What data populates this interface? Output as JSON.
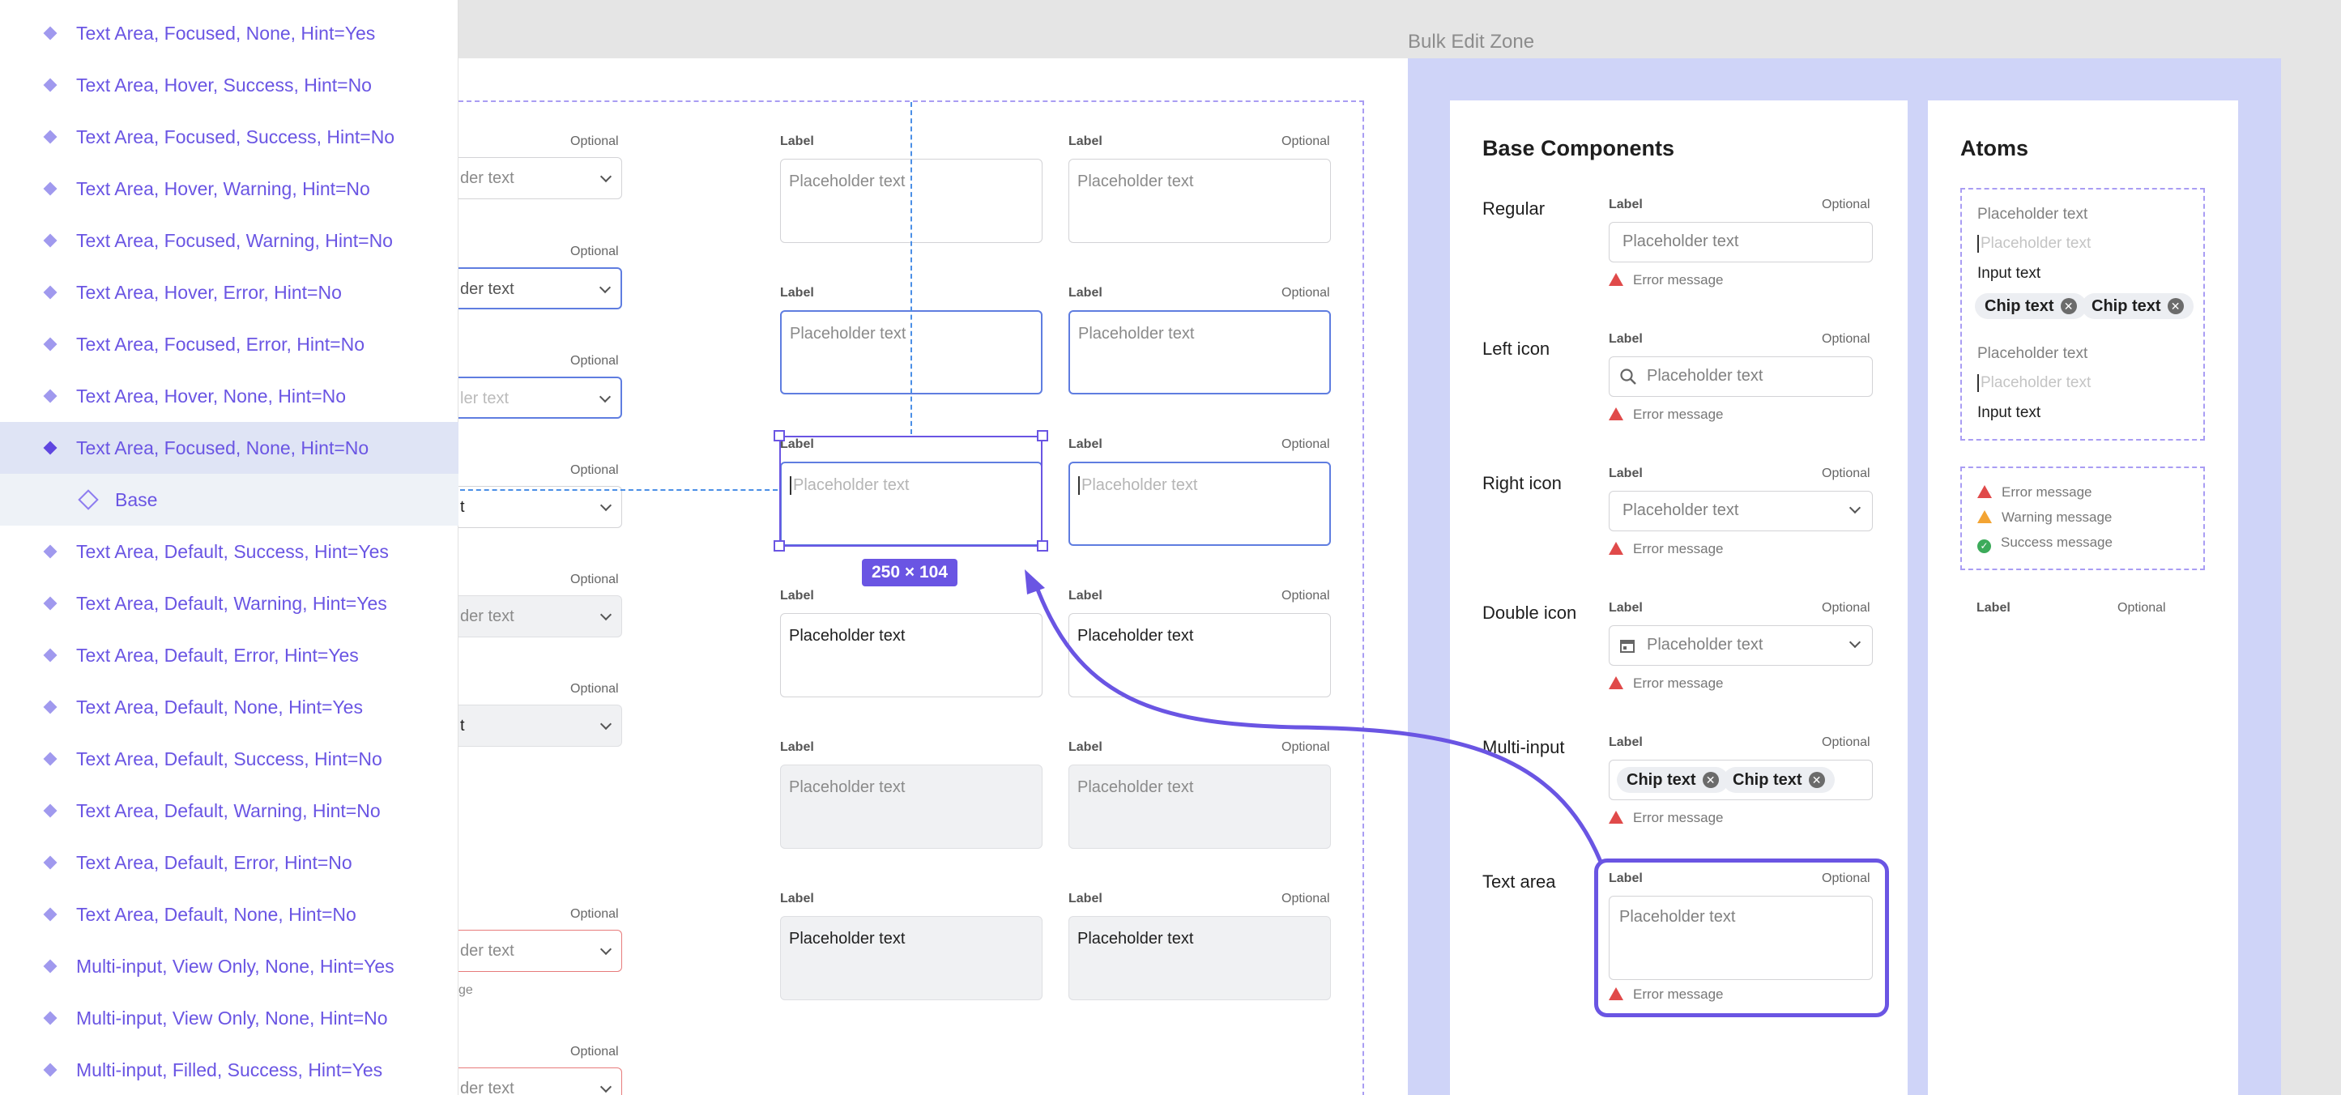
{
  "layers": {
    "items": [
      {
        "label": "Text Area, Focused, None, Hint=Yes"
      },
      {
        "label": "Text Area, Hover, Success, Hint=No"
      },
      {
        "label": "Text Area, Focused, Success, Hint=No"
      },
      {
        "label": "Text Area, Hover, Warning, Hint=No"
      },
      {
        "label": "Text Area, Focused, Warning, Hint=No"
      },
      {
        "label": "Text Area, Hover, Error, Hint=No"
      },
      {
        "label": "Text Area, Focused, Error, Hint=No"
      },
      {
        "label": "Text Area, Hover, None, Hint=No"
      },
      {
        "label": "Text Area, Focused, None, Hint=No"
      },
      {
        "label": "Base"
      },
      {
        "label": "Text Area, Default, Success, Hint=Yes"
      },
      {
        "label": "Text Area, Default, Warning, Hint=Yes"
      },
      {
        "label": "Text Area, Default, Error, Hint=Yes"
      },
      {
        "label": "Text Area, Default, None, Hint=Yes"
      },
      {
        "label": "Text Area, Default, Success, Hint=No"
      },
      {
        "label": "Text Area, Default, Warning, Hint=No"
      },
      {
        "label": "Text Area, Default, Error, Hint=No"
      },
      {
        "label": "Text Area, Default, None, Hint=No"
      },
      {
        "label": "Multi-input, View Only, None, Hint=Yes"
      },
      {
        "label": "Multi-input, View Only, None, Hint=No"
      },
      {
        "label": "Multi-input, Filled, Success, Hint=Yes"
      }
    ]
  },
  "canvas": {
    "label": "Label",
    "optional": "Optional",
    "placeholder": "Placeholder text",
    "placeholder_clipped_der": "der text",
    "placeholder_clipped_ler": "ler text",
    "clipped_t": "t",
    "clipped_ge": "ge",
    "dimension_badge": "250 × 104"
  },
  "bulk": {
    "title": "Bulk Edit Zone",
    "base_title": "Base Components",
    "atoms_title": "Atoms",
    "rows": [
      "Regular",
      "Left icon",
      "Right icon",
      "Double icon",
      "Multi-input",
      "Text area"
    ],
    "label": "Label",
    "optional": "Optional",
    "placeholder": "Placeholder text",
    "error": "Error message",
    "chip": "Chip text",
    "input_text": "Input text",
    "warning": "Warning message",
    "success": "Success message"
  },
  "colors": {
    "accent": "#6a55e3",
    "focus": "#5f7de0",
    "guide": "#4b8fe6",
    "error": "#e04a4a",
    "warning": "#f3a433",
    "success": "#3cab5a",
    "bulk_bg": "#cfd4f8"
  }
}
